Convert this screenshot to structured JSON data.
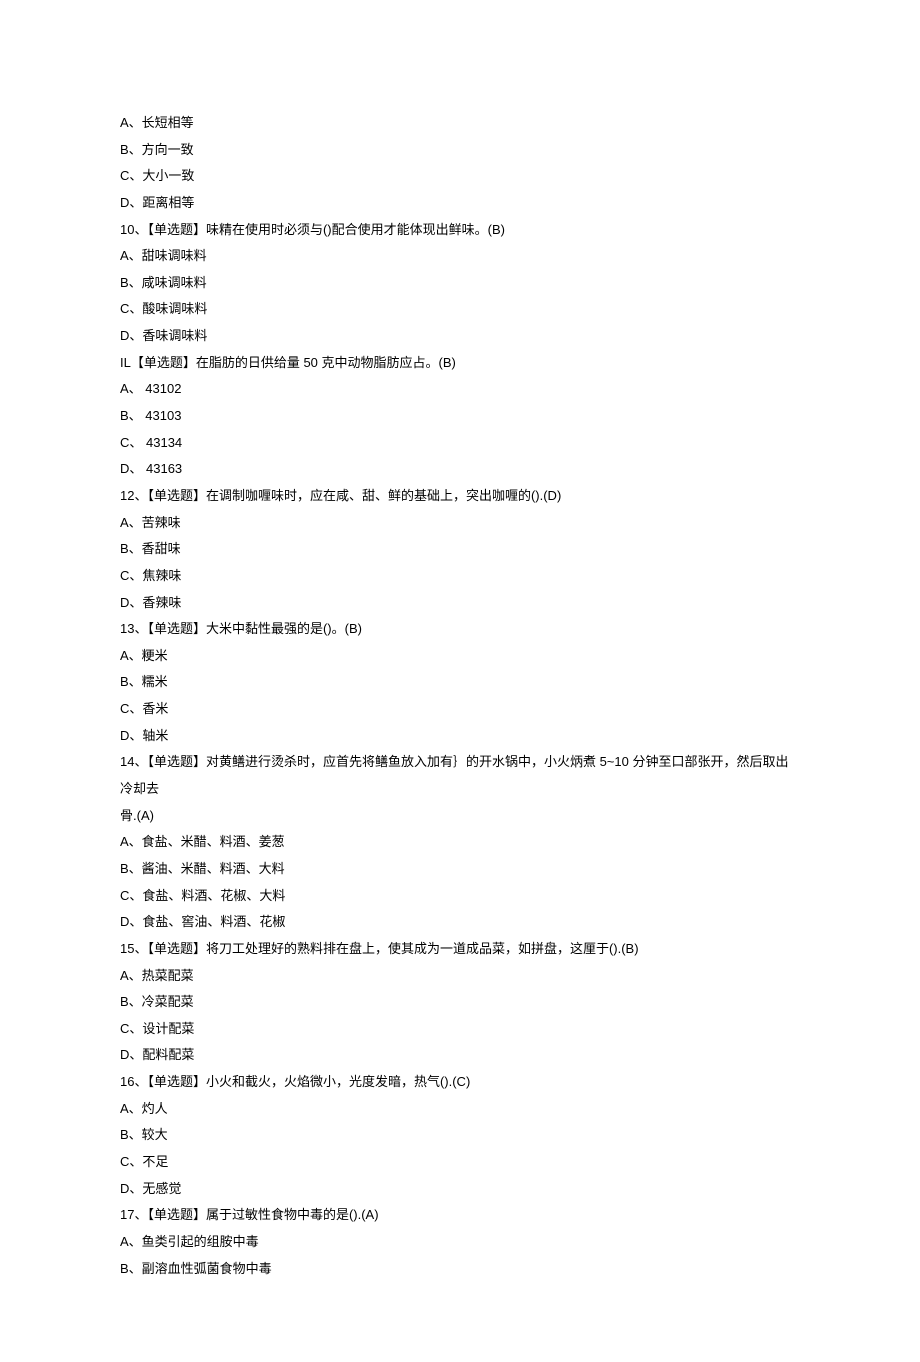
{
  "lines": [
    "A、长短相等",
    "B、方向一致",
    "C、大小一致",
    "D、距离相等",
    "10、【单选题】味精在使用时必须与()配合使用才能体现出鲜味。(B)",
    "A、甜味调味料",
    "B、咸味调味料",
    "C、酸味调味料",
    "D、香味调味料",
    "IL【单选题】在脂肪的日供给量 50 克中动物脂肪应占。(B)",
    "A、 43102",
    "B、 43103",
    "C、 43134",
    "D、 43163",
    "12、【单选题】在调制咖喱味时，应在咸、甜、鲜的基础上，突出咖喱的().(D)",
    "A、苦辣味",
    "B、香甜味",
    "C、焦辣味",
    "D、香辣味",
    "13、【单选题】大米中黏性最强的是()。(B)",
    "A、粳米",
    "B、糯米",
    "C、香米",
    "D、轴米",
    "14、【单选题】对黄鳝进行烫杀时，应首先将鳝鱼放入加有｝的开水锅中，小火炳煮 5~10 分钟至口部张开，然后取出冷却去",
    "骨.(A)",
    "A、食盐、米醋、料酒、姜葱",
    "B、酱油、米醋、料酒、大料",
    "C、食盐、料酒、花椒、大料",
    "D、食盐、窖油、料酒、花椒",
    "15、【单选题】将刀工处理好的熟料排在盘上，使其成为一道成品菜，如拼盘，这厘于().(B)",
    "A、热菜配菜",
    "B、冷菜配菜",
    "C、设计配菜",
    "D、配料配菜",
    "16、【单选题】小火和截火，火焰微小，光度发暗，热气().(C)",
    "A、灼人",
    "B、较大",
    "C、不足",
    "D、无感觉",
    "17、【单选题】属于过敏性食物中毒的是().(A)",
    "A、鱼类引起的组胺中毒",
    "B、副溶血性弧菌食物中毒"
  ]
}
